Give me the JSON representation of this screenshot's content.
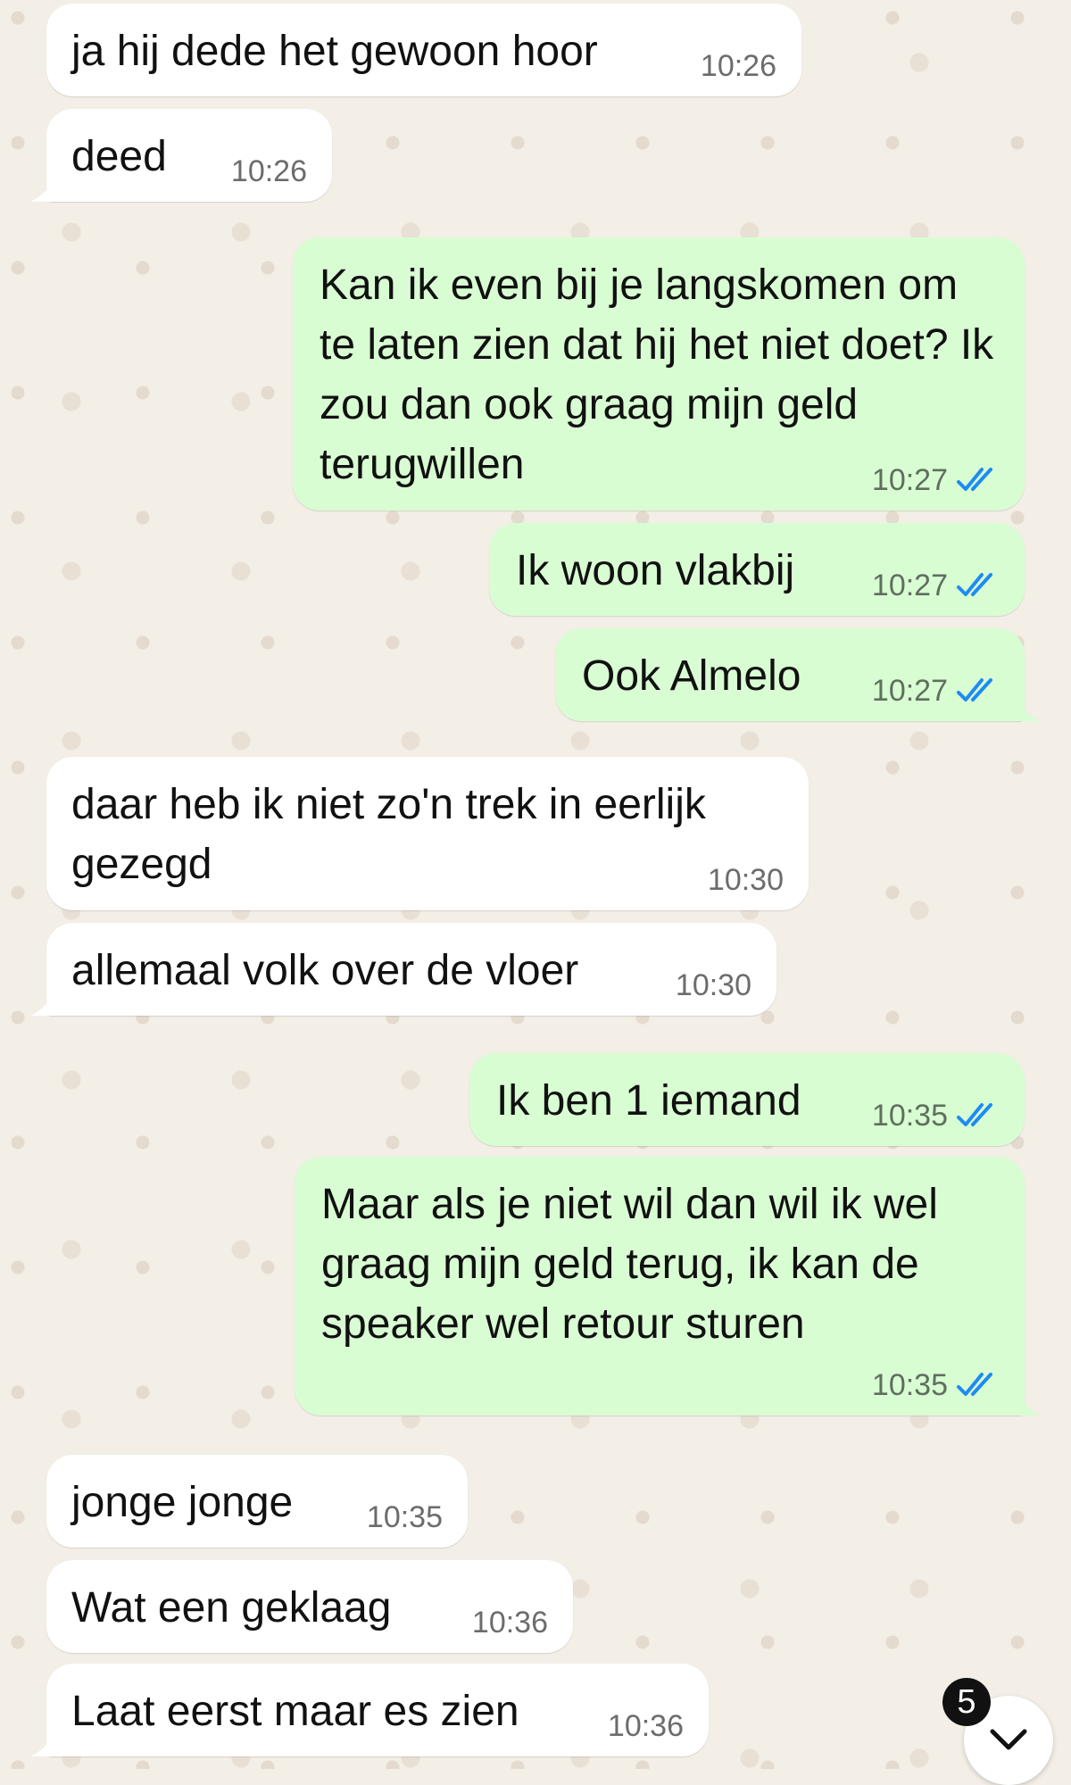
{
  "chat": {
    "messages": [
      {
        "dir": "in",
        "text": "ja hij dede het gewoon hoor",
        "time": "10:26"
      },
      {
        "dir": "in",
        "text": "deed",
        "time": "10:26"
      },
      {
        "dir": "out",
        "text": "Kan ik even bij je langskomen om te laten zien dat hij het niet doet? Ik zou dan ook graag mijn geld terugwillen",
        "time": "10:27",
        "status": "read"
      },
      {
        "dir": "out",
        "text": "Ik woon vlakbij",
        "time": "10:27",
        "status": "read"
      },
      {
        "dir": "out",
        "text": "Ook Almelo",
        "time": "10:27",
        "status": "read"
      },
      {
        "dir": "in",
        "text": "daar heb ik niet zo'n trek in eerlijk gezegd",
        "time": "10:30"
      },
      {
        "dir": "in",
        "text": "allemaal volk over de vloer",
        "time": "10:30"
      },
      {
        "dir": "out",
        "text": "Ik ben 1 iemand",
        "time": "10:35",
        "status": "read"
      },
      {
        "dir": "out",
        "text": "Maar als je niet wil dan wil ik wel graag mijn geld terug, ik kan de speaker wel retour sturen",
        "time": "10:35",
        "status": "read"
      },
      {
        "dir": "in",
        "text": "jonge jonge",
        "time": "10:35"
      },
      {
        "dir": "in",
        "text": "Wat een geklaag",
        "time": "10:36"
      },
      {
        "dir": "in",
        "text": "Laat eerst maar es zien",
        "time": "10:36"
      }
    ]
  },
  "scroll_button": {
    "icon": "chevron-down-icon",
    "unread_count": "5"
  },
  "colors": {
    "background": "#f3eee6",
    "incoming_bubble": "#ffffff",
    "outgoing_bubble": "#d9fdd3",
    "read_ticks": "#1d8cf2"
  }
}
